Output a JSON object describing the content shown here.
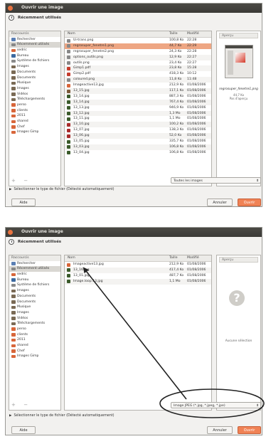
{
  "dialog_title": "Ouvrir une image",
  "places_title": "Récemment utilisés",
  "sidebar": {
    "items": [
      {
        "label": "Raccourcis",
        "type": "header",
        "color": "#ecebe8"
      },
      {
        "label": "Rechercher",
        "icon": "search-icon",
        "color": "#5b7fb4"
      },
      {
        "label": "Récemment utilisés",
        "icon": "clock-icon",
        "color": "#888888",
        "selected": true
      },
      {
        "label": "sedric",
        "icon": "home-icon",
        "color": "#d8663a"
      },
      {
        "label": "Bureau",
        "icon": "desktop-icon",
        "color": "#3c6aa0"
      },
      {
        "label": "Système de fichiers",
        "icon": "drive-icon",
        "color": "#8a8a8a"
      },
      {
        "label": "Images",
        "icon": "folder-icon",
        "color": "#7a6a55"
      },
      {
        "label": "Documents",
        "icon": "folder-icon",
        "color": "#7a6a55"
      },
      {
        "label": "Documents",
        "icon": "folder-icon",
        "color": "#7a6a55"
      },
      {
        "label": "Musique",
        "icon": "music-folder-icon",
        "color": "#7a6a55"
      },
      {
        "label": "Images",
        "icon": "pictures-folder-icon",
        "color": "#7a6a55"
      },
      {
        "label": "Vidéos",
        "icon": "video-folder-icon",
        "color": "#7a6a55"
      },
      {
        "label": "Téléchargements",
        "icon": "download-folder-icon",
        "color": "#7a6a55"
      },
      {
        "label": "perso",
        "icon": "folder-icon",
        "color": "#d8663a"
      },
      {
        "label": "clients",
        "icon": "folder-icon",
        "color": "#d8663a"
      },
      {
        "label": "2011",
        "icon": "folder-icon",
        "color": "#d8663a"
      },
      {
        "label": "shared",
        "icon": "folder-icon",
        "color": "#d8663a"
      },
      {
        "label": "Chef",
        "icon": "folder-icon",
        "color": "#d8663a"
      },
      {
        "label": "Images Gimp",
        "icon": "folder-icon",
        "color": "#d8663a"
      }
    ]
  },
  "columns": {
    "name": "Nom",
    "size": "Taille",
    "modified": "Modifié"
  },
  "files_shot1": [
    {
      "name": "Ui-trans.png",
      "size": "100,8 Ko",
      "date": "22:28",
      "color": "#888888"
    },
    {
      "name": "regrosuper_fenetre1.png",
      "size": "44,7 Ko",
      "date": "22:29",
      "color": "#888888",
      "selected": true
    },
    {
      "name": "regrosuper_fenetre2.png",
      "size": "24,3 Ko",
      "date": "22:28",
      "color": "#888888"
    },
    {
      "name": "options_outils.png",
      "size": "12,9 Ko",
      "date": "22:27",
      "color": "#888888"
    },
    {
      "name": "outils.png",
      "size": "23,4 Ko",
      "date": "22:27",
      "color": "#888888"
    },
    {
      "name": "Gimp1.pdf",
      "size": "23,8 Ko",
      "date": "15:28",
      "color": "#c53b2b"
    },
    {
      "name": "Gimp2.pdf",
      "size": "418,3 Ko",
      "date": "10:12",
      "color": "#c53b2b"
    },
    {
      "name": "coloured.png",
      "size": "11,8 Ko",
      "date": "11:48",
      "color": "#888888"
    },
    {
      "name": "Imageactive13.jpg",
      "size": "212,9 Ko",
      "date": "01/08/2006",
      "color": "#d8663a"
    },
    {
      "name": "13_15.jpg",
      "size": "117,1 Ko",
      "date": "01/08/2006",
      "color": "#7c5a3a"
    },
    {
      "name": "13_14.jpg",
      "size": "887,3 Ko",
      "date": "01/08/2006",
      "color": "#3a5a2a"
    },
    {
      "name": "13_14.jpg",
      "size": "767,4 Ko",
      "date": "01/08/2006",
      "color": "#3a5a2a"
    },
    {
      "name": "13_13.jpg",
      "size": "946,9 Ko",
      "date": "01/08/2006",
      "color": "#3a5a2a"
    },
    {
      "name": "13_12.jpg",
      "size": "1,3 Mo",
      "date": "01/08/2006",
      "color": "#3a5a2a"
    },
    {
      "name": "13_11.jpg",
      "size": "1,1 Mo",
      "date": "01/08/2006",
      "color": "#3a5a2a"
    },
    {
      "name": "13_10.jpg",
      "size": "100,2 Ko",
      "date": "01/08/2006",
      "color": "#a82a2a"
    },
    {
      "name": "13_07.jpg",
      "size": "138,3 Ko",
      "date": "01/08/2006",
      "color": "#a82a2a"
    },
    {
      "name": "13_06.jpg",
      "size": "52,0 Ko",
      "date": "01/08/2006",
      "color": "#a82a2a"
    },
    {
      "name": "13_05.jpg",
      "size": "335,7 Ko",
      "date": "01/08/2006",
      "color": "#3a5a2a"
    },
    {
      "name": "13_03.jpg",
      "size": "106,8 Ko",
      "date": "01/08/2006",
      "color": "#3a5a2a"
    },
    {
      "name": "13_04.jpg",
      "size": "106,8 Ko",
      "date": "01/08/2006",
      "color": "#3a5a2a"
    }
  ],
  "files_shot2": [
    {
      "name": "Imageactive13.jpg",
      "size": "212,9 Ko",
      "date": "01/08/2006",
      "color": "#d8663a"
    },
    {
      "name": "13_16.jpg",
      "size": "417,4 Ko",
      "date": "01/08/2006",
      "color": "#3a5a2a"
    },
    {
      "name": "13_01.jpg",
      "size": "487,7 Ko",
      "date": "01/08/2006",
      "color": "#3a5a2a"
    },
    {
      "name": "Image.loop.13.jpg",
      "size": "1,1 Mo",
      "date": "01/08/2006",
      "color": "#3a5a2a"
    }
  ],
  "preview_shot1": {
    "label": "Aperçu",
    "filename": "regrosuper_fenetre1.png",
    "line2": "44,7 Ko",
    "line3": "Pas d'aperçu"
  },
  "preview_shot2": {
    "label": "Aperçu",
    "empty_icon": "?",
    "empty_text": "Aucune sélection"
  },
  "add_remove": {
    "add": "+",
    "remove": "−"
  },
  "filter_shot1": "Toutes les images",
  "filter_shot2": "Image JPEG (*.jpg, *.jpeg, *.jpe)",
  "filetype_expander": "Sélectionner le type de fichier (Détecté automatiquement)",
  "buttons": {
    "help": "Aide",
    "cancel": "Annuler",
    "open": "Ouvrir"
  },
  "colors": {
    "accent": "#f08255",
    "selection": "#eea683",
    "titlebar": "#3b3a36"
  }
}
